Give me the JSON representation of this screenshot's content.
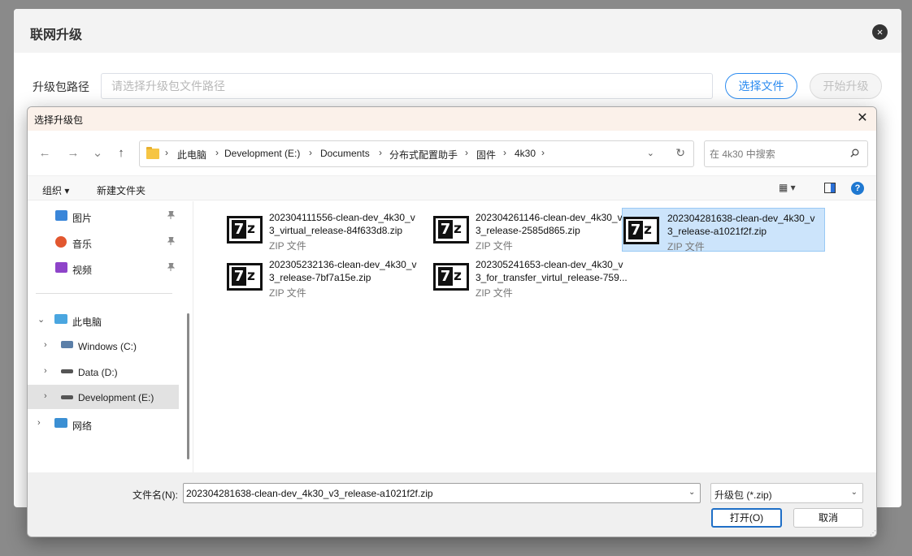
{
  "web_modal": {
    "title": "联网升级",
    "close_icon": "×",
    "form_label": "升级包路径",
    "path_placeholder": "请选择升级包文件路径",
    "select_file_btn": "选择文件",
    "start_upgrade_btn": "开始升级"
  },
  "file_dialog": {
    "title": "选择升级包",
    "close_icon": "✕",
    "nav": {
      "back_icon": "←",
      "forward_icon": "→",
      "recent_icon": "⌄",
      "up_icon": "↑"
    },
    "address": {
      "breadcrumbs": [
        "此电脑",
        "Development (E:)",
        "Documents",
        "分布式配置助手",
        "固件",
        "4k30"
      ],
      "separator": "›",
      "dropdown_icon": "⌄",
      "refresh_icon": "↻"
    },
    "search": {
      "placeholder": "在 4k30 中搜索"
    },
    "toolbar": {
      "organize": "组织 ▾",
      "new_folder": "新建文件夹",
      "view_icon": "▦ ▾",
      "help_icon": "?"
    },
    "nav_pane": {
      "quick_items": [
        {
          "label": "图片",
          "pin": "📌"
        },
        {
          "label": "音乐",
          "pin": "📌"
        },
        {
          "label": "视频",
          "pin": "📌"
        }
      ],
      "this_pc": "此电脑",
      "drives": [
        {
          "label": "Windows (C:)"
        },
        {
          "label": "Data (D:)"
        },
        {
          "label": "Development (E:)"
        }
      ],
      "network": "网络",
      "expanded_chevron": "⌄",
      "collapsed_chevron": "›"
    },
    "files": [
      {
        "name": "202304111556-clean-dev_4k30_v\n3_virtual_release-84f633d8.zip",
        "type": "ZIP 文件",
        "icon_a": "7",
        "icon_b": "z"
      },
      {
        "name": "202304261146-clean-dev_4k30_v\n3_release-2585d865.zip",
        "type": "ZIP 文件",
        "icon_a": "7",
        "icon_b": "z"
      },
      {
        "name": "202304281638-clean-dev_4k30_v\n3_release-a1021f2f.zip",
        "type": "ZIP 文件",
        "icon_a": "7",
        "icon_b": "z"
      },
      {
        "name": "202305232136-clean-dev_4k30_v\n3_release-7bf7a15e.zip",
        "type": "ZIP 文件",
        "icon_a": "7",
        "icon_b": "z"
      },
      {
        "name": "202305241653-clean-dev_4k30_v\n3_for_transfer_virtul_release-759...",
        "type": "ZIP 文件",
        "icon_a": "7",
        "icon_b": "z"
      }
    ],
    "footer": {
      "filename_label": "文件名(N):",
      "filename_value": "202304281638-clean-dev_4k30_v3_release-a1021f2f.zip",
      "dropdown_icon": "⌄",
      "file_type": "升级包 (*.zip)",
      "open_btn": "打开(O)",
      "cancel_btn": "取消",
      "grip": "⋰"
    }
  }
}
